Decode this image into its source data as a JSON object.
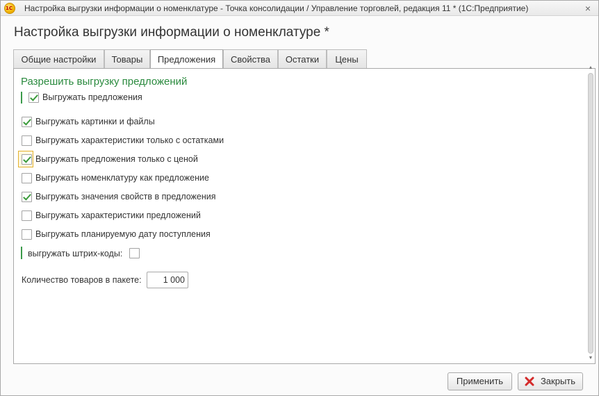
{
  "window": {
    "title": "Настройка выгрузки информации о номенклатуре - Точка консолидации / Управление торговлей, редакция 11 * (1С:Предприятие)",
    "app_icon": "1c-logo-icon",
    "app_icon_text": "1С",
    "close_glyph": "×"
  },
  "form": {
    "title": "Настройка выгрузки информации о номенклатуре *"
  },
  "tabs": [
    {
      "label": "Общие настройки"
    },
    {
      "label": "Товары"
    },
    {
      "label": "Предложения"
    },
    {
      "label": "Свойства"
    },
    {
      "label": "Остатки"
    },
    {
      "label": "Цены"
    }
  ],
  "active_tab": "Предложения",
  "group": {
    "title": "Разрешить выгрузку предложений",
    "accent_color": "#2a8a3e"
  },
  "options": [
    {
      "label": "Выгружать предложения",
      "checked": true
    },
    {
      "label": "Выгружать картинки и файлы",
      "checked": true
    },
    {
      "label": "Выгружать характеристики только с остатками",
      "checked": false
    },
    {
      "label": "Выгружать предложения только с ценой",
      "checked": true
    },
    {
      "label": "Выгружать номенклатуру как предложение",
      "checked": false
    },
    {
      "label": "Выгружать значения свойств в предложения",
      "checked": true
    },
    {
      "label": "Выгружать характеристики предложений",
      "checked": false
    },
    {
      "label": "Выгружать планируемую дату поступления",
      "checked": false
    }
  ],
  "barcodes": {
    "label": "выгружать штрих-коды:",
    "checked": false
  },
  "batch": {
    "label": "Количество товаров в пакете:",
    "value": "1 000"
  },
  "buttons": {
    "apply": "Применить",
    "close": "Закрыть",
    "close_icon": "red-x-icon"
  },
  "scrollbar": {
    "up_glyph": "▲",
    "down_glyph": "▼"
  }
}
